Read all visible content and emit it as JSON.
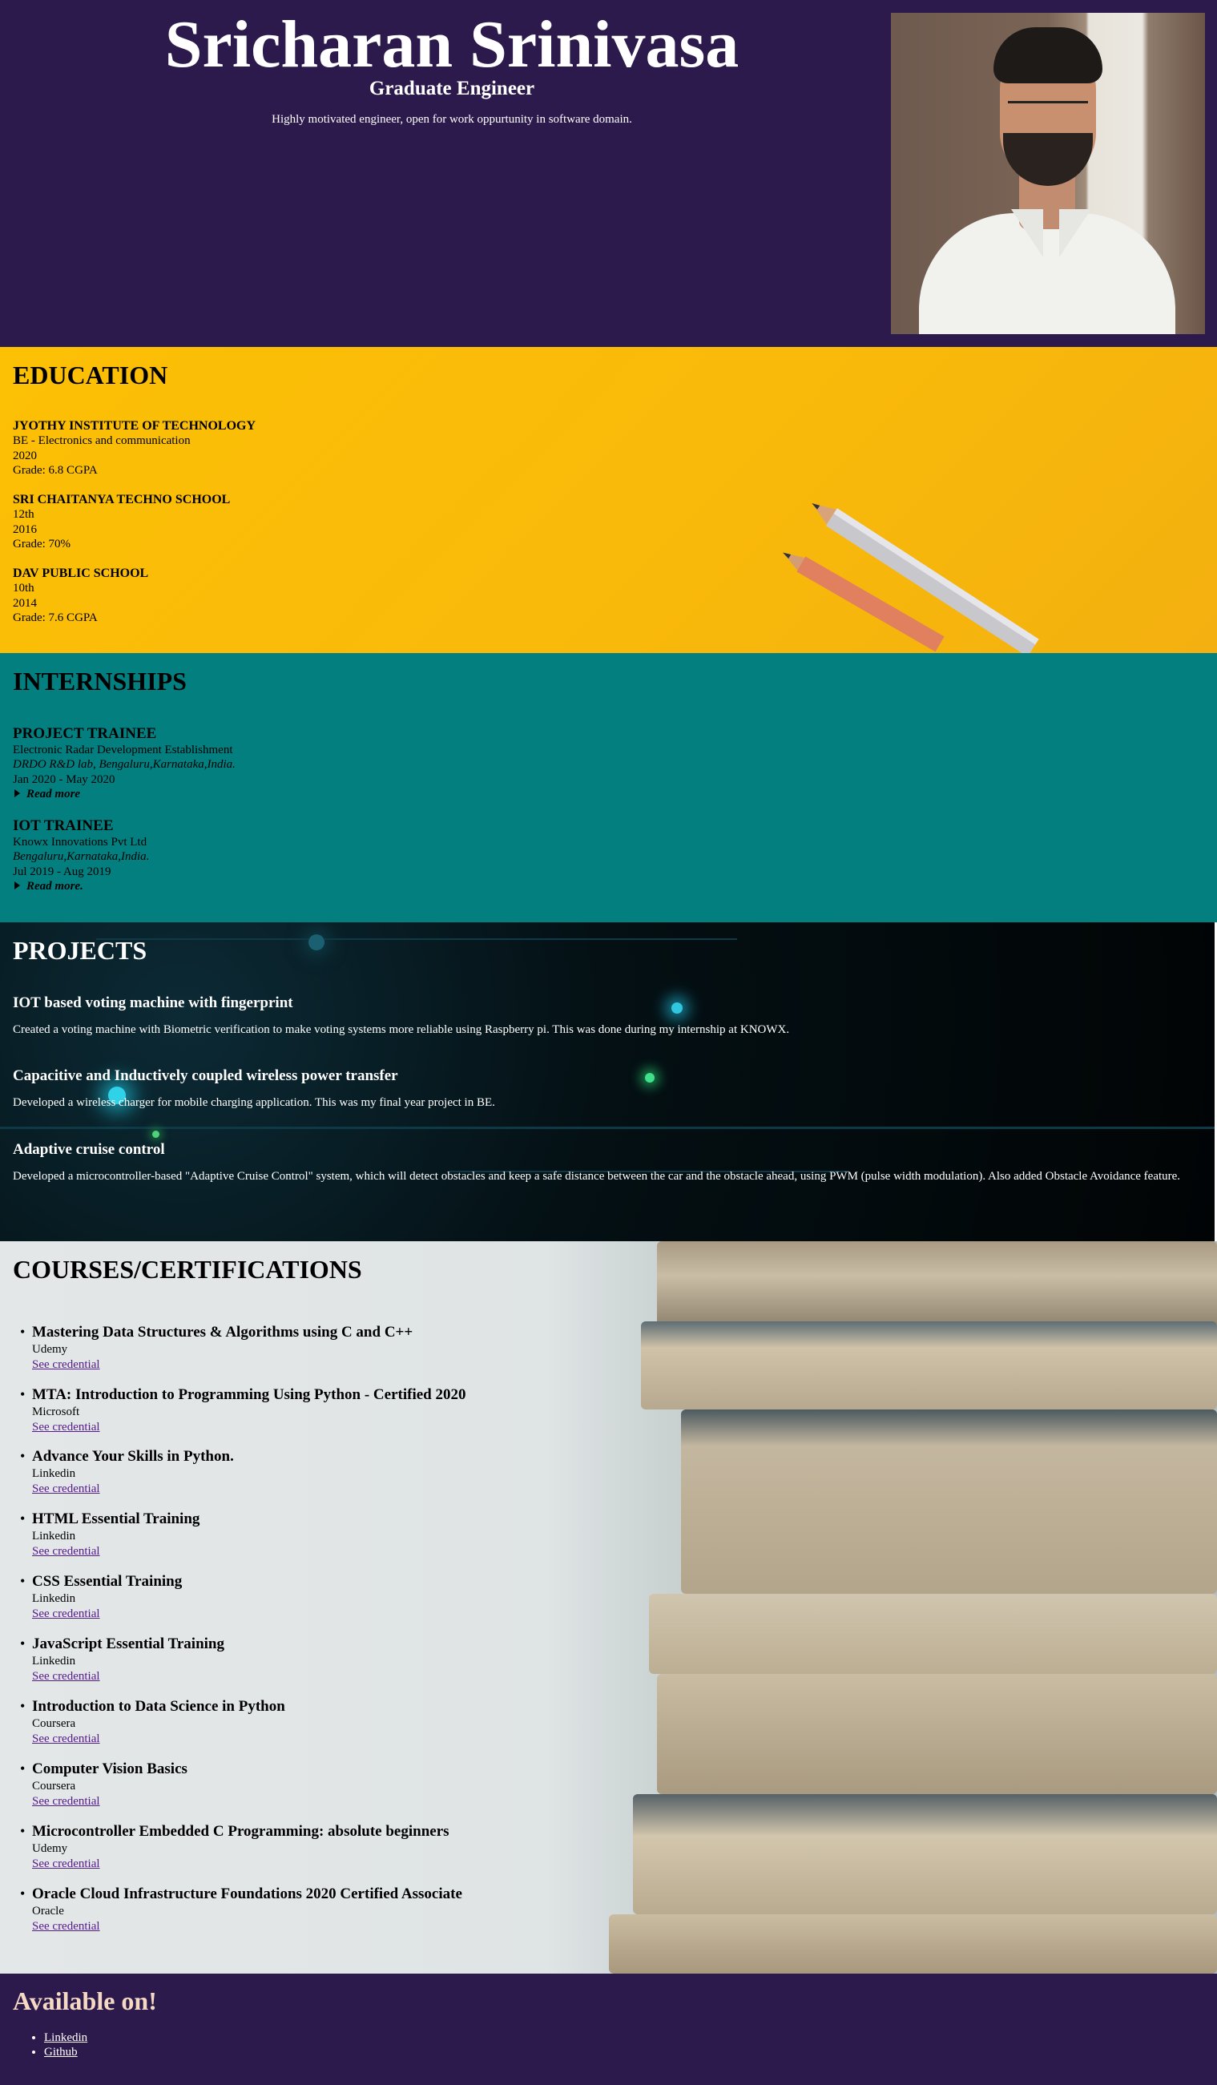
{
  "header": {
    "name": "Sricharan Srinivasa",
    "role": "Graduate Engineer",
    "tagline": "Highly motivated engineer, open for work oppurtunity in software domain."
  },
  "education": {
    "title": "EDUCATION",
    "items": [
      {
        "school": "JYOTHY INSTITUTE OF TECHNOLOGY",
        "course": "BE - Electronics and communication",
        "year": "2020",
        "grade": "Grade: 6.8 CGPA"
      },
      {
        "school": "SRI CHAITANYA TECHNO SCHOOL",
        "course": "12th",
        "year": "2016",
        "grade": "Grade: 70%"
      },
      {
        "school": "DAV PUBLIC SCHOOL",
        "course": "10th",
        "year": "2014",
        "grade": "Grade: 7.6 CGPA"
      }
    ]
  },
  "internships": {
    "title": "INTERNSHIPS",
    "items": [
      {
        "role": "PROJECT TRAINEE",
        "org": "Electronic Radar Development Establishment",
        "location": "DRDO R&D lab, Bengaluru,Karnataka,India.",
        "dates": "Jan 2020 - May 2020",
        "more": "Read more"
      },
      {
        "role": "IOT TRAINEE",
        "org": "Knowx Innovations Pvt Ltd",
        "location": "Bengaluru,Karnataka,India.",
        "dates": "Jul 2019 - Aug 2019",
        "more": "Read more."
      }
    ]
  },
  "projects": {
    "title": "PROJECTS",
    "items": [
      {
        "title": "IOT based voting machine with fingerprint",
        "desc": "Created a voting machine with Biometric verification to make voting systems more reliable using Raspberry pi. This was done during my internship at KNOWX."
      },
      {
        "title": "Capacitive and Inductively coupled wireless power transfer",
        "desc": "Developed a wireless charger for mobile charging application. This was my final year project in BE."
      },
      {
        "title": "Adaptive cruise control",
        "desc": "Developed a microcontroller-based \"Adaptive Cruise Control\" system, which will detect obstacles and keep a safe distance between the car and the obstacle ahead, using PWM (pulse width modulation). Also added Obstacle Avoidance feature."
      }
    ]
  },
  "courses": {
    "title": "COURSES/CERTIFICATIONS",
    "link_label": "See credential",
    "items": [
      {
        "title": "Mastering Data Structures & Algorithms using C and C++",
        "provider": "Udemy"
      },
      {
        "title": "MTA: Introduction to Programming Using Python - Certified 2020",
        "provider": "Microsoft"
      },
      {
        "title": "Advance Your Skills in Python.",
        "provider": "Linkedin"
      },
      {
        "title": "HTML Essential Training",
        "provider": "Linkedin"
      },
      {
        "title": "CSS Essential Training",
        "provider": "Linkedin"
      },
      {
        "title": "JavaScript Essential Training",
        "provider": "Linkedin"
      },
      {
        "title": "Introduction to Data Science in Python",
        "provider": "Coursera"
      },
      {
        "title": "Computer Vision Basics",
        "provider": "Coursera"
      },
      {
        "title": "Microcontroller Embedded C Programming: absolute beginners",
        "provider": "Udemy"
      },
      {
        "title": "Oracle Cloud Infrastructure Foundations 2020 Certified Associate",
        "provider": "Oracle"
      }
    ]
  },
  "footer": {
    "title": "Available on!",
    "links": [
      "Linkedin",
      "Github"
    ]
  },
  "colors": {
    "header_bg": "#2c1a4d",
    "education_bg": "#fcc005",
    "internships_bg": "#047f80",
    "projects_bg": "#041014",
    "courses_bg": "#e4e7e7",
    "footer_title": "#f6d9c2"
  }
}
